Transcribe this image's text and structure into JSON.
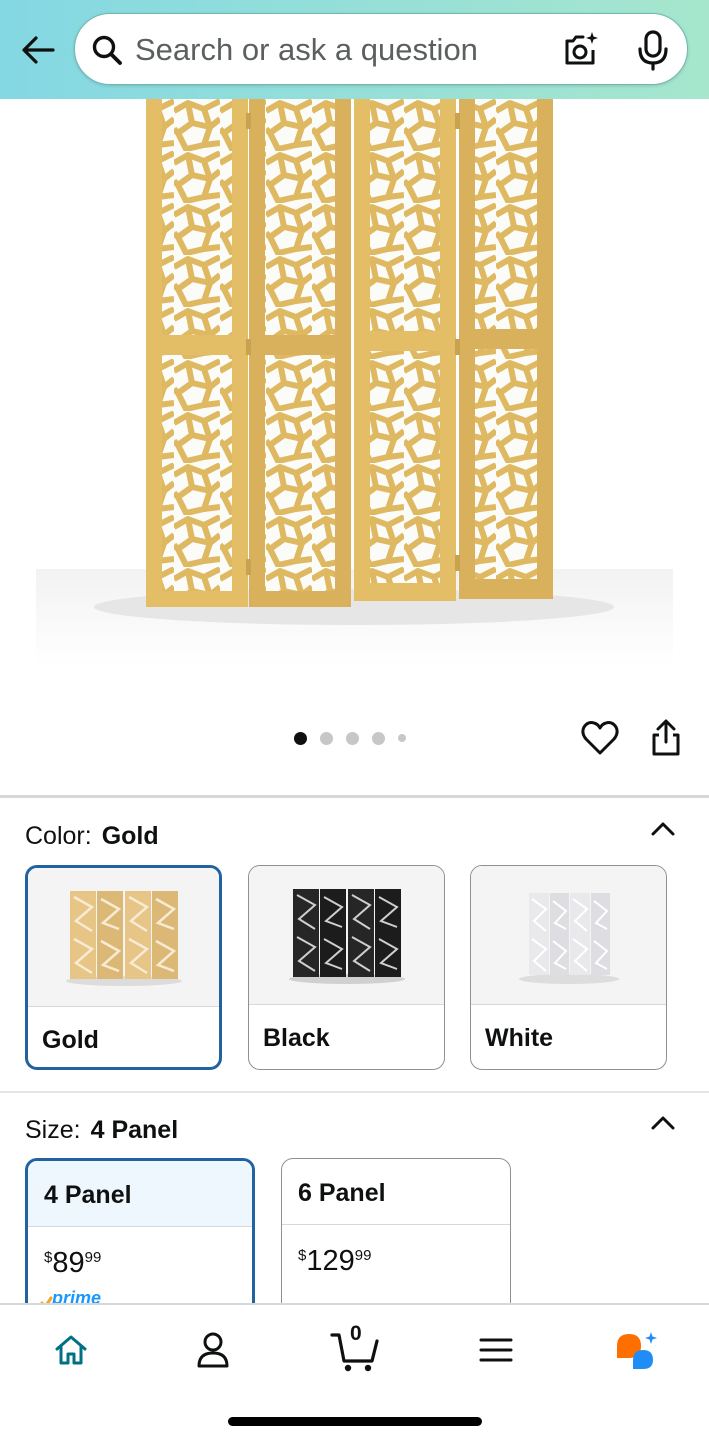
{
  "search": {
    "placeholder": "Search or ask a question"
  },
  "carousel": {
    "count": 5,
    "active_index": 0
  },
  "color": {
    "label": "Color:",
    "selected": "Gold",
    "options": [
      {
        "name": "Gold",
        "swatch_color": "#e8c06a"
      },
      {
        "name": "Black",
        "swatch_color": "#1e1e1e"
      },
      {
        "name": "White",
        "swatch_color": "#eeeeee"
      }
    ]
  },
  "size": {
    "label": "Size:",
    "selected": "4 Panel",
    "options": [
      {
        "name": "4 Panel",
        "price_dollars": "89",
        "price_cents": "99",
        "prime": "prime"
      },
      {
        "name": "6 Panel",
        "price_dollars": "129",
        "price_cents": "99"
      }
    ]
  },
  "cart": {
    "count": "0"
  },
  "colors": {
    "accent": "#2162a1",
    "nav_active": "#007185",
    "header_start": "#84d8e3",
    "header_end": "#a6e6cd"
  }
}
